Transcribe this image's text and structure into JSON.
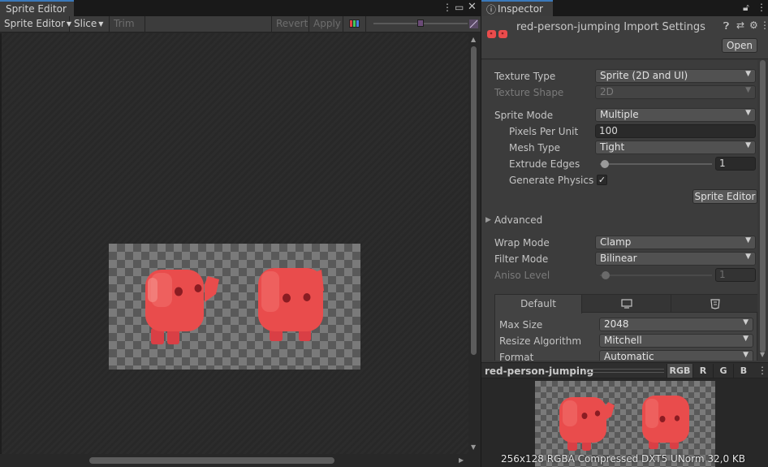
{
  "sprite_editor": {
    "tab_title": "Sprite Editor",
    "toolbar": {
      "mode_label": "Sprite Editor",
      "slice_label": "Slice",
      "trim_label": "Trim",
      "revert_label": "Revert",
      "apply_label": "Apply"
    },
    "sprite_count": 2
  },
  "inspector": {
    "tab_title": "Inspector",
    "asset_title": "red-person-jumping Import Settings",
    "open_label": "Open",
    "texture_type": {
      "label": "Texture Type",
      "value": "Sprite (2D and UI)"
    },
    "texture_shape": {
      "label": "Texture Shape",
      "value": "2D"
    },
    "sprite_mode": {
      "label": "Sprite Mode",
      "value": "Multiple"
    },
    "pixels_per_unit": {
      "label": "Pixels Per Unit",
      "value": "100"
    },
    "mesh_type": {
      "label": "Mesh Type",
      "value": "Tight"
    },
    "extrude_edges": {
      "label": "Extrude Edges",
      "value": "1"
    },
    "generate_physics": {
      "label": "Generate Physics S",
      "checked": "✓"
    },
    "sprite_editor_button": "Sprite Editor",
    "advanced_label": "Advanced",
    "wrap_mode": {
      "label": "Wrap Mode",
      "value": "Clamp"
    },
    "filter_mode": {
      "label": "Filter Mode",
      "value": "Bilinear"
    },
    "aniso_level": {
      "label": "Aniso Level",
      "value": "1"
    },
    "platform_tabs": {
      "default_label": "Default"
    },
    "max_size": {
      "label": "Max Size",
      "value": "2048"
    },
    "resize_algorithm": {
      "label": "Resize Algorithm",
      "value": "Mitchell"
    },
    "format": {
      "label": "Format",
      "value": "Automatic"
    }
  },
  "preview": {
    "name": "red-person-jumping",
    "channels": [
      "RGB",
      "R",
      "G",
      "B"
    ],
    "info": "256x128  RGBA Compressed DXT5 UNorm   32,0 KB"
  },
  "colors": {
    "accent": "#3a79bb",
    "sprite_red": "#e94c4c",
    "sprite_eye": "#8a1c22"
  }
}
